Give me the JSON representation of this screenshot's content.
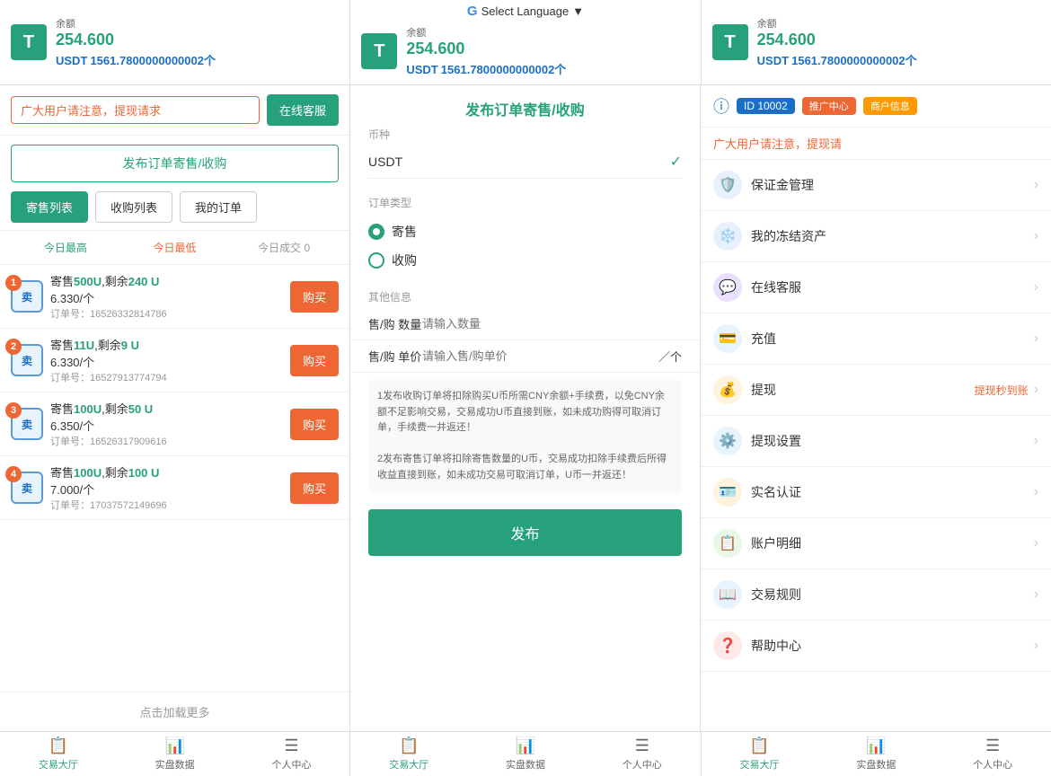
{
  "header": {
    "sections": [
      {
        "balance_label": "余额",
        "balance_value": "254.600",
        "usdt_label": "USDT",
        "usdt_value": "1561.7800000000002个"
      },
      {
        "select_language": "Select Language",
        "balance_label": "余额",
        "balance_value": "254.600",
        "usdt_label": "USDT",
        "usdt_value": "1561.7800000000002个"
      },
      {
        "balance_label": "余额",
        "balance_value": "254.600",
        "usdt_label": "USDT",
        "usdt_value": "1561.7800000000002个"
      }
    ]
  },
  "left": {
    "notice_text": "广大用户请注意，提现请求",
    "online_service_btn": "在线客服",
    "publish_btn": "发布订单寄售/收购",
    "tabs": [
      "寄售列表",
      "收购列表",
      "我的订单"
    ],
    "active_tab": 0,
    "sort_items": [
      "今日最高",
      "今日最低",
      "今日成交 0"
    ],
    "orders": [
      {
        "num": 1,
        "title": "寄售500U,剩余240 U",
        "price": "6.330/个",
        "order_id": "订单号：16526332814786",
        "buy_btn": "购买"
      },
      {
        "num": 2,
        "title": "寄售11U,剩余9 U",
        "price": "6.330/个",
        "order_id": "订单号：16527913774794",
        "buy_btn": "购买"
      },
      {
        "num": 3,
        "title": "寄售100U,剩余50 U",
        "price": "6.350/个",
        "order_id": "订单号：16526317909616",
        "buy_btn": "购买"
      },
      {
        "num": 4,
        "title": "寄售100U,剩余100 U",
        "price": "7.000/个",
        "order_id": "订单号：17037572149696",
        "buy_btn": "购买"
      }
    ],
    "load_more": "点击加载更多"
  },
  "middle": {
    "title": "发布订单寄售/收购",
    "currency_label": "币种",
    "currency_value": "USDT",
    "order_type_label": "订单类型",
    "order_types": [
      "寄售",
      "收购"
    ],
    "active_order_type": 0,
    "other_info_label": "其他信息",
    "quantity_label": "售/购 数量",
    "quantity_placeholder": "请输入数量",
    "price_label": "售/购 单价",
    "price_placeholder": "请输入售/购单价",
    "price_suffix": "／个",
    "notice": "1发布收购订单将扣除购买U币所需CNY余额+手续费，以免CNY余额不足影响交易，交易成功U币直接到账，如未成功购得可取消订单，手续费一并返还！\n2发布寄售订单将扣除寄售数量的U币，交易成功扣除手续费后所得收益直接到账，如未成功交易可取消订单，U币一并返还！",
    "publish_btn": "发布"
  },
  "right": {
    "id": "ID 10002",
    "promo_badge": "推广中心",
    "merchant_badge": "商户信息",
    "notice_text": "广大用户请注意，提现请",
    "menu_items": [
      {
        "icon": "🛡️",
        "icon_class": "icon-shield",
        "text": "保证金管理"
      },
      {
        "icon": "❄️",
        "icon_class": "icon-freeze",
        "text": "我的冻结资产"
      },
      {
        "icon": "💬",
        "icon_class": "icon-service",
        "text": "在线客服"
      },
      {
        "icon": "💳",
        "icon_class": "icon-recharge",
        "text": "充值"
      },
      {
        "icon": "💰",
        "icon_class": "icon-withdraw",
        "text": "提现",
        "extra": "提现秒到账"
      },
      {
        "icon": "⚙️",
        "icon_class": "icon-wdset",
        "text": "提现设置"
      },
      {
        "icon": "🪪",
        "icon_class": "icon-realname",
        "text": "实名认证"
      },
      {
        "icon": "📋",
        "icon_class": "icon-account",
        "text": "账户明细"
      },
      {
        "icon": "📖",
        "icon_class": "icon-rules",
        "text": "交易规则"
      },
      {
        "icon": "❓",
        "icon_class": "icon-help",
        "text": "帮助中心"
      }
    ]
  },
  "bottom_nav": {
    "sections": [
      {
        "items": [
          {
            "icon": "📋",
            "label": "交易大厅",
            "active": true
          },
          {
            "icon": "📊",
            "label": "实盘数据",
            "active": false
          },
          {
            "icon": "☰",
            "label": "个人中心",
            "active": false
          }
        ]
      },
      {
        "items": [
          {
            "icon": "📋",
            "label": "交易大厅",
            "active": true
          },
          {
            "icon": "📊",
            "label": "实盘数据",
            "active": false
          },
          {
            "icon": "☰",
            "label": "个人中心",
            "active": false
          }
        ]
      },
      {
        "items": [
          {
            "icon": "📋",
            "label": "交易大厅",
            "active": true
          },
          {
            "icon": "📊",
            "label": "实盘数据",
            "active": false
          },
          {
            "icon": "☰",
            "label": "个人中心",
            "active": false
          }
        ]
      }
    ]
  },
  "colors": {
    "green": "#26a17b",
    "red": "#e63",
    "blue": "#1a6fc4"
  }
}
